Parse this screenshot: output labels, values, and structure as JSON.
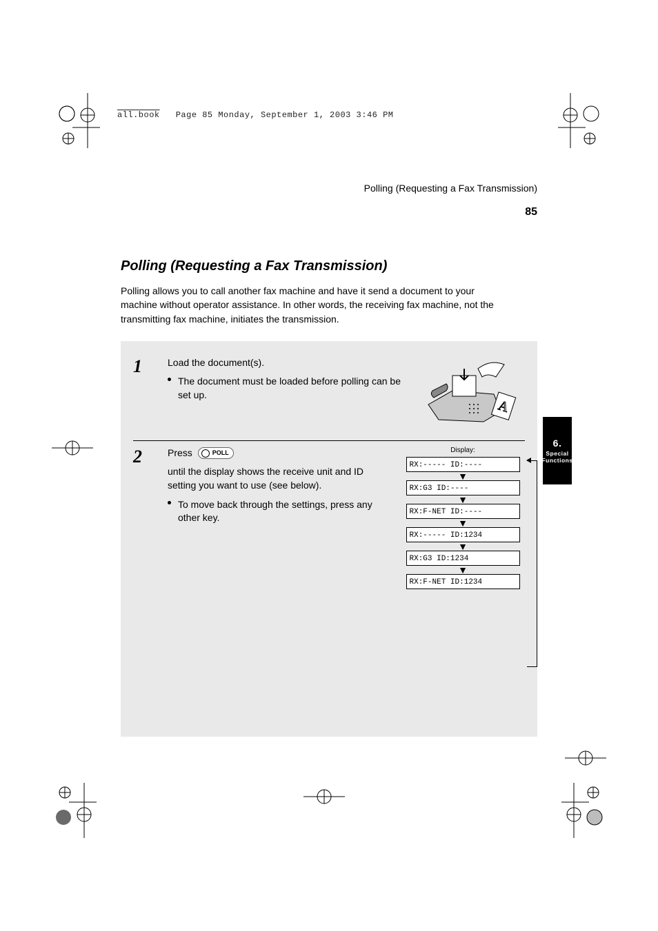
{
  "header_slug": {
    "filename": "all.book",
    "pageinfo": "Page 85  Monday, September 1, 2003  3:46 PM"
  },
  "running_head": {
    "title": "Polling (Requesting a Fax Transmission)",
    "page_number": "85"
  },
  "sidebar_tab": {
    "number": "6.",
    "label": "Special Functions"
  },
  "section_title": "Polling (Requesting a Fax Transmission)",
  "intro_text": "Polling allows you to call another fax machine and have it send a document to your machine without operator assistance. In other words, the receiving fax machine, not the transmitting fax machine, initiates the transmission.",
  "steps": {
    "step1": {
      "num": "1",
      "text": "Load the document(s).",
      "bullet": "The document must be loaded before polling can be set up."
    },
    "step2": {
      "num": "2",
      "button_prefix": "Press",
      "button_label": "POLL",
      "button_suffix": "until the display shows the receive unit and ID setting you want to use (see below).",
      "bullet": "To move back through the settings, press any other key."
    }
  },
  "display_flow": {
    "caption": "Display:",
    "boxes": [
      "RX:-----  ID:----",
      "RX:G3     ID:----",
      "RX:F-NET  ID:----",
      "RX:-----  ID:1234",
      "RX:G3     ID:1234",
      "RX:F-NET  ID:1234"
    ]
  }
}
